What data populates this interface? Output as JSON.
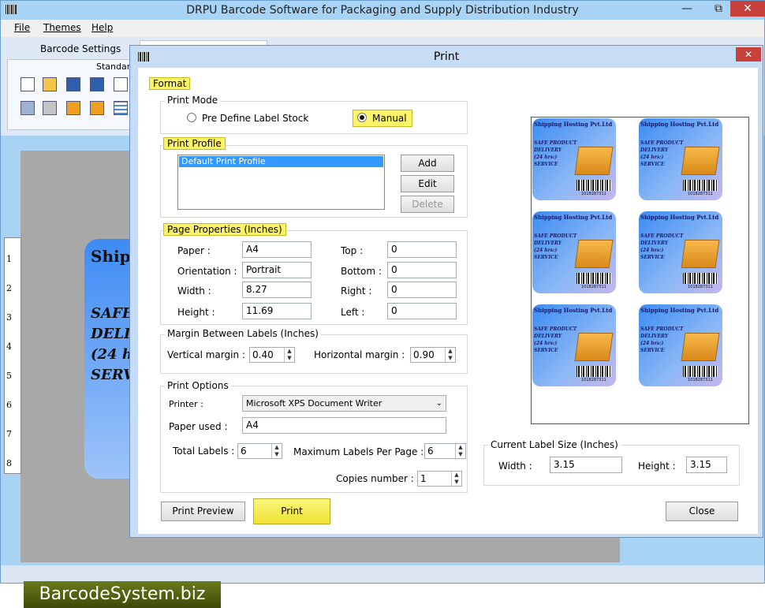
{
  "app": {
    "title": "DRPU Barcode Software for Packaging and Supply Distribution Industry",
    "window_controls": {
      "minimize": "—",
      "maximize": "⧉",
      "close": "✕"
    },
    "menu": [
      "File",
      "Themes",
      "Help"
    ],
    "ribbon_tab": "Barcode Settings",
    "ribbon_group": "Standard"
  },
  "background_label": {
    "title": "Ship",
    "lines": [
      "SAFE",
      "DELI",
      "(24 h",
      "SERV"
    ]
  },
  "ruler_numbers": [
    "1",
    "2",
    "3",
    "4",
    "5",
    "6",
    "7",
    "8"
  ],
  "dialog": {
    "title": "Print",
    "close": "✕",
    "format_label": "Format",
    "print_mode": {
      "title": "Print Mode",
      "options": [
        "Pre Define Label Stock",
        "Manual"
      ],
      "selected": "Manual"
    },
    "print_profile": {
      "title": "Print Profile",
      "items": [
        "Default Print Profile"
      ],
      "add": "Add",
      "edit": "Edit",
      "delete": "Delete"
    },
    "page_properties": {
      "title": "Page Properties (Inches)",
      "paper_label": "Paper :",
      "paper": "A4",
      "orientation_label": "Orientation :",
      "orientation": "Portrait",
      "width_label": "Width :",
      "width": "8.27",
      "height_label": "Height :",
      "height": "11.69",
      "top_label": "Top :",
      "top": "0",
      "bottom_label": "Bottom :",
      "bottom": "0",
      "right_label": "Right :",
      "right": "0",
      "left_label": "Left :",
      "left": "0"
    },
    "margin": {
      "title": "Margin Between Labels (Inches)",
      "vertical_label": "Vertical margin :",
      "vertical": "0.40",
      "horizontal_label": "Horizontal margin :",
      "horizontal": "0.90"
    },
    "print_options": {
      "title": "Print Options",
      "printer_label": "Printer :",
      "printer": "Microsoft XPS Document Writer",
      "paper_used_label": "Paper used :",
      "paper_used": "A4",
      "total_labels_label": "Total Labels :",
      "total_labels": "6",
      "max_labels_label": "Maximum Labels Per Page :",
      "max_labels": "6",
      "copies_label": "Copies number :",
      "copies": "1"
    },
    "preview_label": {
      "company": "Shipping Hosting Pvt.Ltd",
      "lines": [
        "SAFE PRODUCT",
        "DELIVERY",
        "(24 hrs:)",
        "SERVICE"
      ],
      "barcode_number": "1018287311"
    },
    "current_size": {
      "title": "Current Label Size (Inches)",
      "width_label": "Width :",
      "width": "3.15",
      "height_label": "Height :",
      "height": "3.15"
    },
    "buttons": {
      "preview": "Print Preview",
      "print": "Print",
      "close": "Close"
    }
  },
  "brand": "BarcodeSystem.biz"
}
